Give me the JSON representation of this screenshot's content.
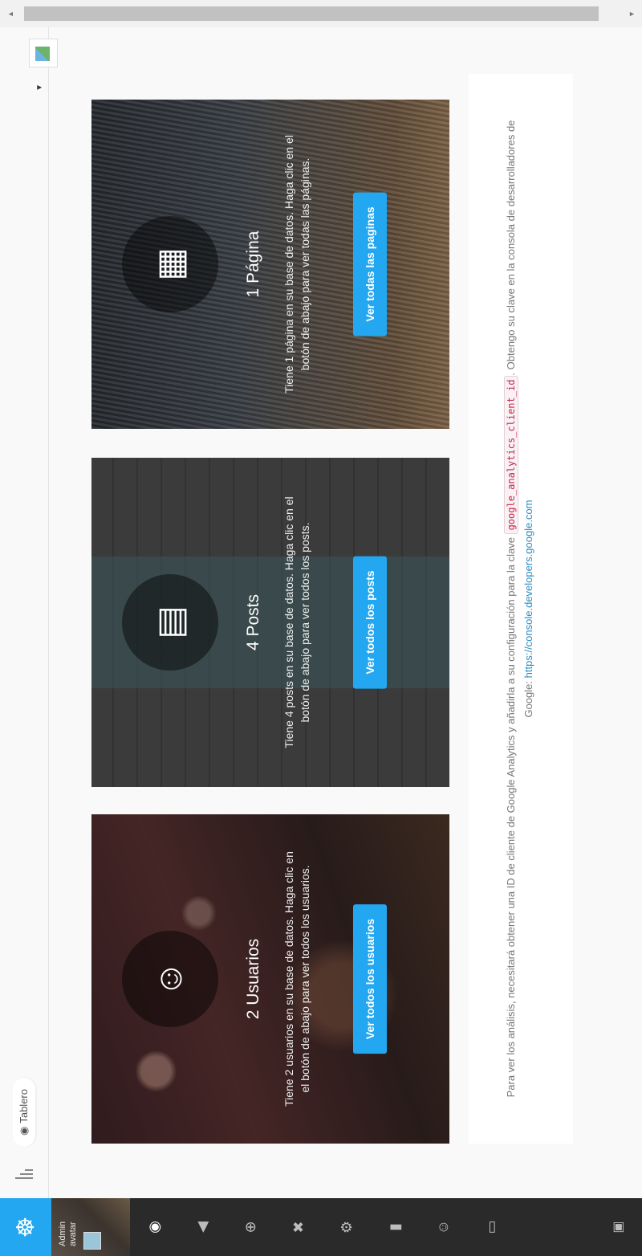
{
  "app": {
    "logo_icon": "helm-icon",
    "accent_color": "#22a7f0"
  },
  "sidebar": {
    "profile": {
      "name": "Admin avatar"
    },
    "items": [
      {
        "icon": "palette-icon",
        "glyph": "◉",
        "active": true
      },
      {
        "icon": "bullhorn-icon",
        "glyph": "◀"
      },
      {
        "icon": "bread-icon",
        "glyph": "⊕"
      },
      {
        "icon": "tools-icon",
        "glyph": "✖"
      },
      {
        "icon": "settings-icon",
        "glyph": "⚙"
      },
      {
        "icon": "book-icon",
        "glyph": "▮"
      },
      {
        "icon": "people-icon",
        "glyph": "☺"
      },
      {
        "icon": "bread-alt-icon",
        "glyph": "▭"
      }
    ],
    "bottom_icon": "tablet-icon"
  },
  "topbar": {
    "breadcrumb": "Tablero",
    "breadcrumb_icon": "palette-icon"
  },
  "cards": [
    {
      "title": "2 Usuarios",
      "description": "Tiene 2 usuarios en su base de datos. Haga clic en el botón de abajo para ver todos los usuarios.",
      "button": "Ver todos los usuarios",
      "icon": "people-icon"
    },
    {
      "title": "4 Posts",
      "description": "Tiene 4 posts en su base de datos. Haga clic en el botón de abajo para ver todos los posts.",
      "button": "Ver todos los posts",
      "icon": "news-icon"
    },
    {
      "title": "1 Página",
      "description": "Tiene 1 página en su base de datos. Haga clic en el botón de abajo para ver todas las páginas.",
      "button": "Ver todas las paginas",
      "icon": "file-text-icon"
    }
  ],
  "analytics": {
    "text_before": "Para ver los análisis, necesitará obtener una ID de cliente de Google Analytics y añadirla a su configuración para la clave",
    "key": "google_analytics_client_id",
    "text_after": ". Obtengo su clave en la consola de desarrolladores de Google:",
    "link": "https://console.developers.google.com"
  }
}
